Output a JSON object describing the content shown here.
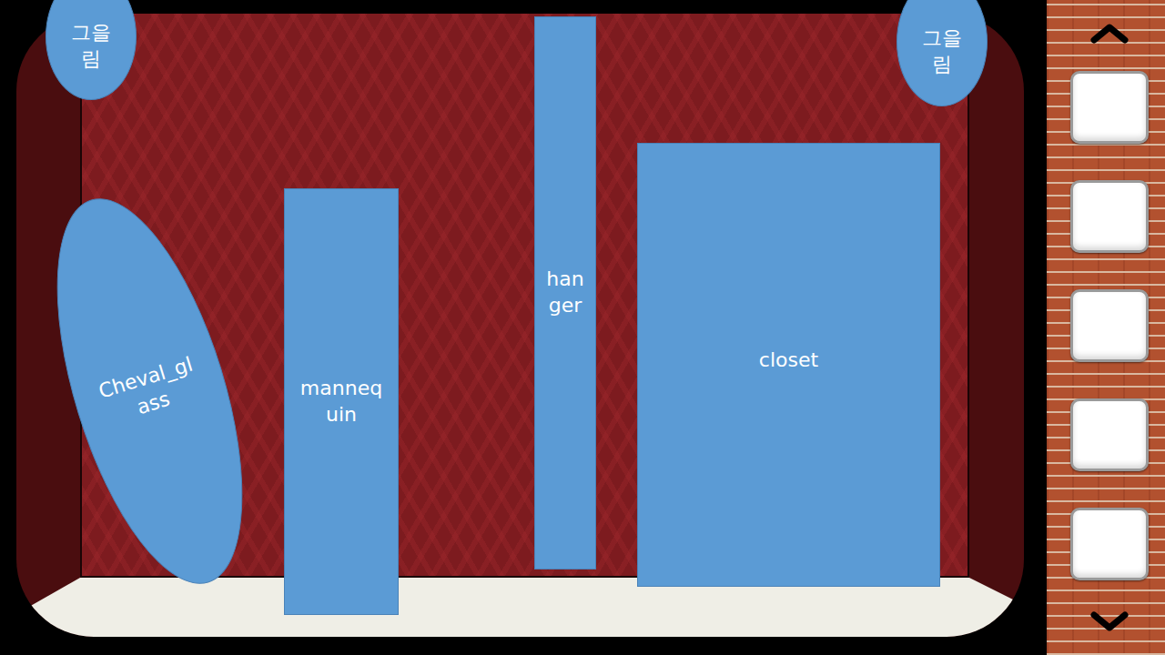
{
  "scene": {
    "objects": [
      {
        "label": "그을림",
        "shape": "ellipse"
      },
      {
        "label": "그을림",
        "shape": "ellipse"
      },
      {
        "label": "Cheval_glass",
        "shape": "ellipse"
      },
      {
        "label": "mannequin",
        "shape": "rect"
      },
      {
        "label": "hanger",
        "shape": "rect"
      },
      {
        "label": "closet",
        "shape": "rect"
      }
    ]
  },
  "inventory": {
    "slots": [
      {
        "filled": false
      },
      {
        "filled": false
      },
      {
        "filled": false
      },
      {
        "filled": false
      },
      {
        "filled": false
      }
    ]
  }
}
